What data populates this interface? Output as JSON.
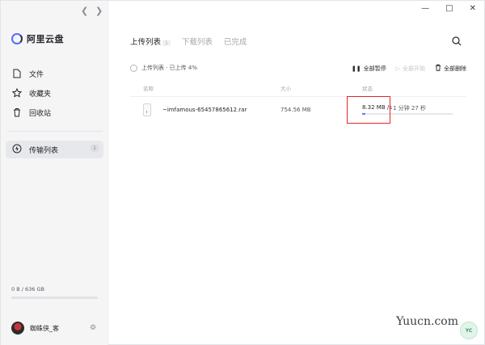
{
  "sidebar": {
    "brand": "阿里云盘",
    "items": [
      {
        "label": "文件"
      },
      {
        "label": "收藏夹"
      },
      {
        "label": "回收站"
      }
    ],
    "transfer": {
      "label": "传输列表",
      "badge": "1"
    },
    "storage": "0 B / 636 GB",
    "user": "蜘蛛侠_客"
  },
  "tabs": [
    {
      "label": "上传列表",
      "count": "1"
    },
    {
      "label": "下载列表"
    },
    {
      "label": "已完成"
    }
  ],
  "toolbar": {
    "select_label": "上传列表 · 已上传 4%",
    "pause_all": "全部暂停",
    "start_all": "全部开始",
    "delete_all": "全部删除"
  },
  "table": {
    "headers": [
      "名称",
      "大小",
      "状态"
    ],
    "rows": [
      {
        "name": "~imfamous-65457865612.rar",
        "size": "754.56 MB",
        "speed": "8.32 MB /s",
        "remaining": "1 分钟 27 秒",
        "progress": 0.04
      }
    ]
  },
  "watermark": "Yuucn.com",
  "accent": "#637dff",
  "highlight_color": "#e3262b"
}
